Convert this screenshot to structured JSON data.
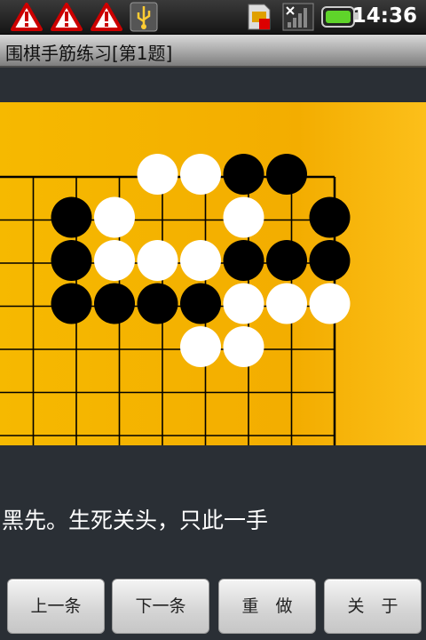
{
  "status_bar": {
    "time": "14:36",
    "icons": [
      "warning-icon",
      "warning-icon",
      "warning-icon",
      "usb-icon",
      "sim-card-icon",
      "signal-icon",
      "battery-icon"
    ]
  },
  "title_bar": {
    "title": "围棋手筋练习[第1题]"
  },
  "board": {
    "black_stones": [
      [
        5,
        0
      ],
      [
        6,
        0
      ],
      [
        1,
        1
      ],
      [
        7,
        1
      ],
      [
        1,
        2
      ],
      [
        5,
        2
      ],
      [
        6,
        2
      ],
      [
        7,
        2
      ],
      [
        1,
        3
      ],
      [
        2,
        3
      ],
      [
        3,
        3
      ],
      [
        4,
        3
      ]
    ],
    "white_stones": [
      [
        3,
        0
      ],
      [
        4,
        0
      ],
      [
        2,
        1
      ],
      [
        5,
        1
      ],
      [
        2,
        2
      ],
      [
        3,
        2
      ],
      [
        4,
        2
      ],
      [
        5,
        3
      ],
      [
        6,
        3
      ],
      [
        7,
        3
      ],
      [
        4,
        4
      ],
      [
        5,
        4
      ]
    ],
    "colors": {
      "board": "#f6b900",
      "black": "#000000",
      "white": "#ffffff",
      "line": "#000000"
    }
  },
  "problem": {
    "text": "黑先。生死关头，只此一手"
  },
  "buttons": {
    "prev": "上一条",
    "next": "下一条",
    "redo": "重　做",
    "about": "关　于"
  }
}
